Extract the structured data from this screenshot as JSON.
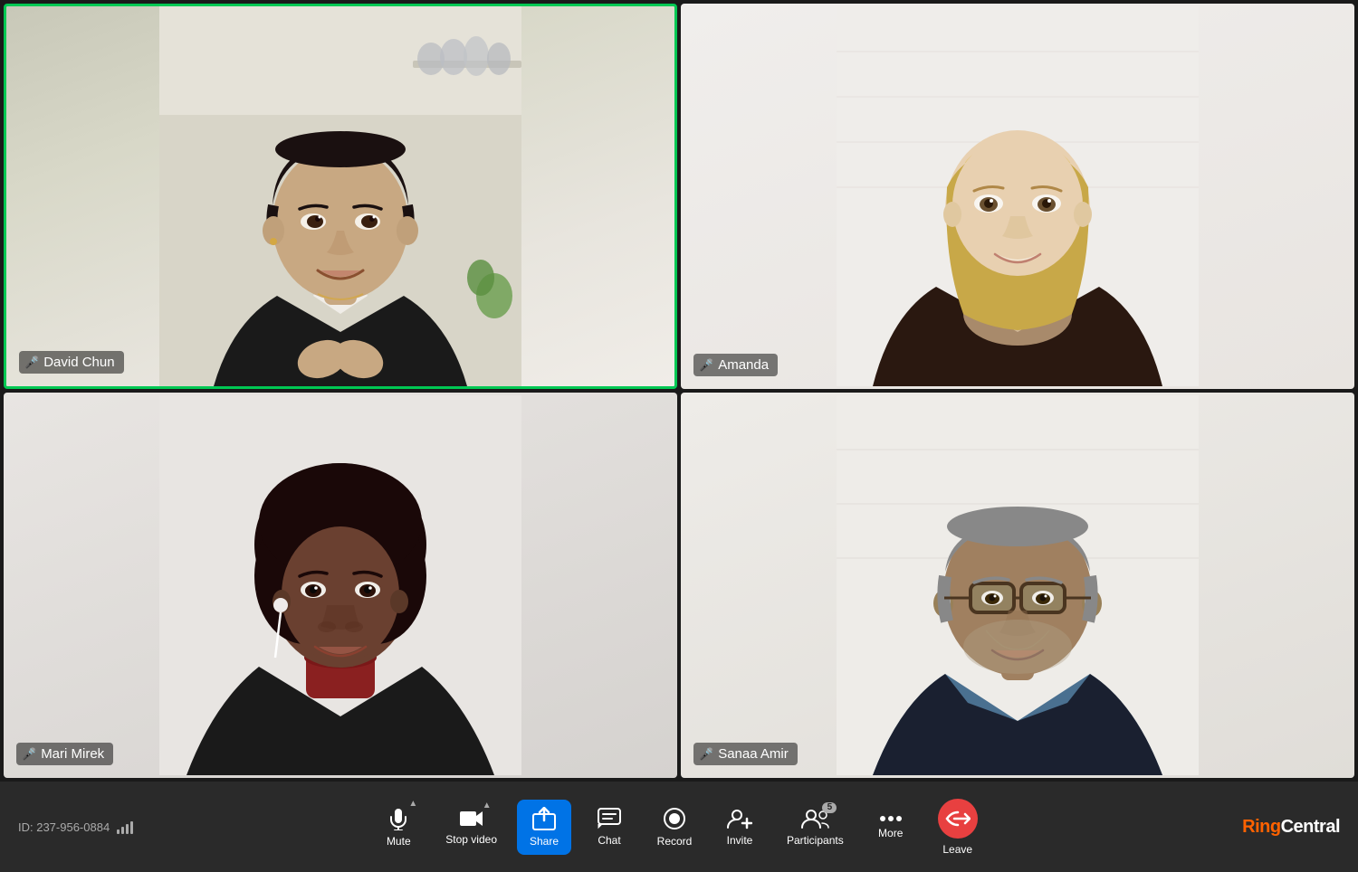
{
  "meeting": {
    "id": "ID: 237-956-0884",
    "active_speaker": "david_chun"
  },
  "participants": [
    {
      "id": "david_chun",
      "name": "David Chun",
      "position": "top-left",
      "mic_active": true,
      "mic_muted": false,
      "active_speaker": true
    },
    {
      "id": "amanda",
      "name": "Amanda",
      "position": "top-right",
      "mic_active": true,
      "mic_muted": true,
      "active_speaker": false
    },
    {
      "id": "mari_mirek",
      "name": "Mari Mirek",
      "position": "bottom-left",
      "mic_active": true,
      "mic_muted": false,
      "active_speaker": false
    },
    {
      "id": "sanaa_amir",
      "name": "Sanaa Amir",
      "position": "bottom-right",
      "mic_active": true,
      "mic_muted": false,
      "active_speaker": false
    }
  ],
  "toolbar": {
    "meeting_id": "ID: 237-956-0884",
    "buttons": [
      {
        "id": "mute",
        "label": "Mute",
        "has_chevron": true
      },
      {
        "id": "stop_video",
        "label": "Stop video",
        "has_chevron": true
      },
      {
        "id": "share",
        "label": "Share",
        "has_chevron": false,
        "highlight": true
      },
      {
        "id": "chat",
        "label": "Chat",
        "has_chevron": false
      },
      {
        "id": "record",
        "label": "Record",
        "has_chevron": false
      },
      {
        "id": "invite",
        "label": "Invite",
        "has_chevron": false
      },
      {
        "id": "participants",
        "label": "Participants",
        "has_chevron": false,
        "badge": "5"
      },
      {
        "id": "more",
        "label": "More",
        "has_chevron": false
      },
      {
        "id": "leave",
        "label": "Leave",
        "has_chevron": false
      }
    ],
    "brand": {
      "ring": "Ring",
      "central": "Central"
    }
  }
}
